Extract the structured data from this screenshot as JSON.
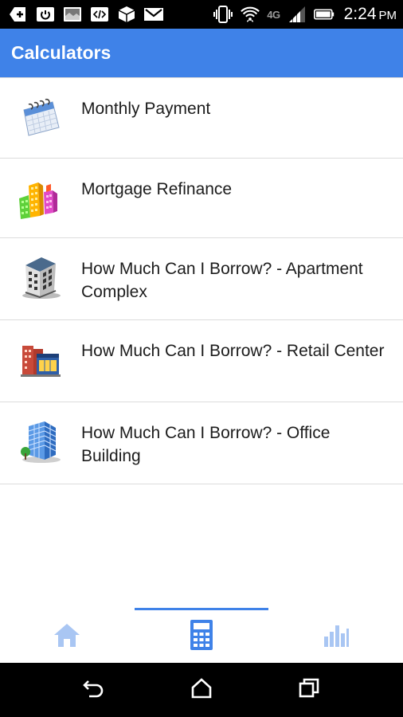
{
  "status_bar": {
    "time": "2:24",
    "ampm": "PM",
    "network": "4G",
    "icons": [
      "add-notification-icon",
      "power-icon",
      "image-icon",
      "code-icon",
      "dropbox-icon",
      "gmail-icon",
      "vibrate-icon",
      "wifi-icon",
      "signal-icon",
      "battery-icon"
    ]
  },
  "app_bar": {
    "title": "Calculators"
  },
  "calculators": [
    {
      "label": "Monthly Payment",
      "icon": "calendar-icon"
    },
    {
      "label": "Mortgage Refinance",
      "icon": "buildings-icon"
    },
    {
      "label": "How Much Can I Borrow? - Apartment Complex",
      "icon": "apartment-building-icon"
    },
    {
      "label": "How Much Can I Borrow? - Retail Center",
      "icon": "retail-center-icon"
    },
    {
      "label": "How Much Can I Borrow? - Office Building",
      "icon": "office-building-icon"
    }
  ],
  "tabs": [
    {
      "name": "home",
      "icon": "home-icon",
      "active": false
    },
    {
      "name": "calculators",
      "icon": "calculator-icon",
      "active": true
    },
    {
      "name": "stats",
      "icon": "bar-chart-icon",
      "active": false
    }
  ],
  "colors": {
    "accent": "#3f82e8",
    "tab_inactive": "#a9c6f3",
    "divider": "#dcdcdc"
  }
}
